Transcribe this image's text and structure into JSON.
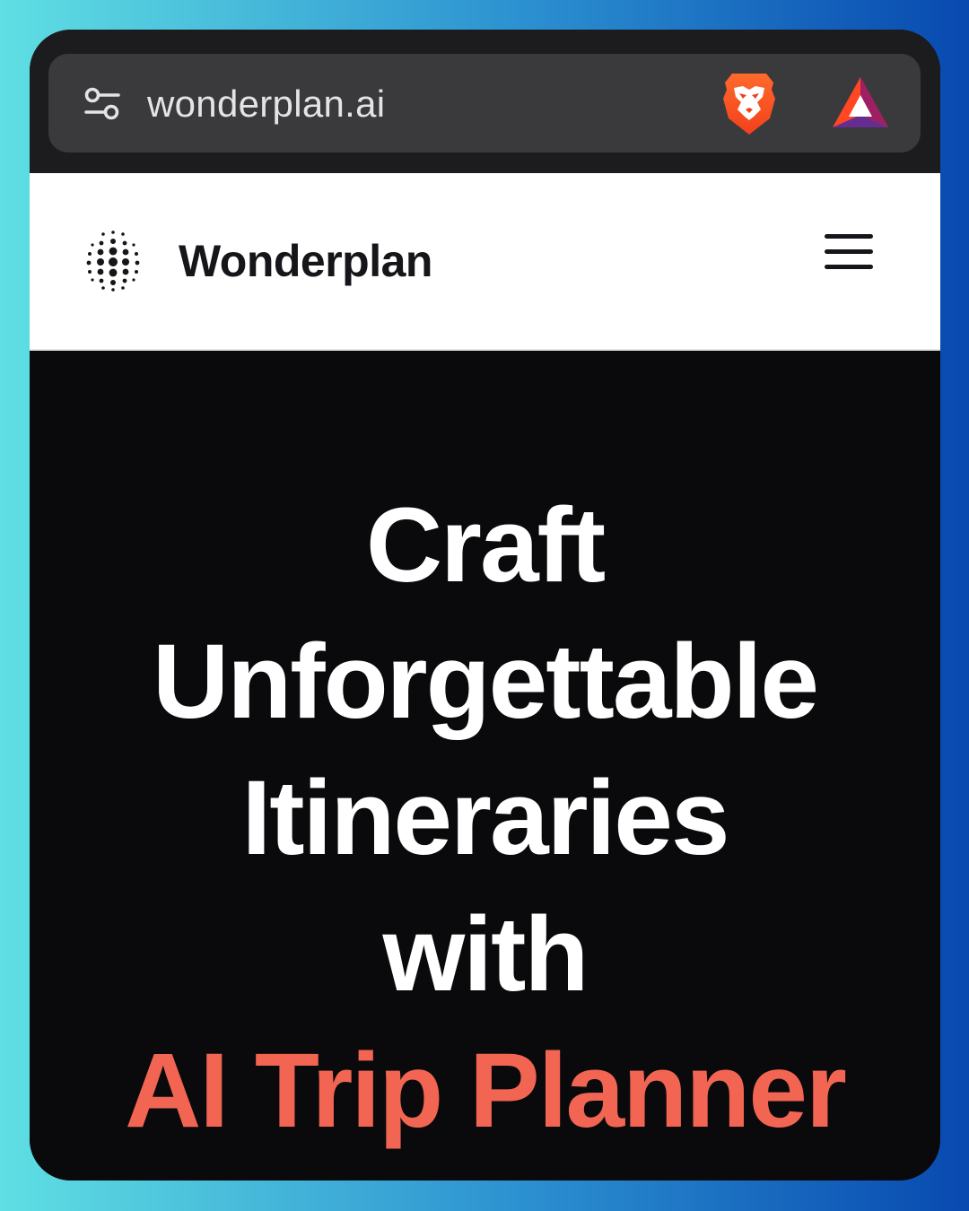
{
  "browser": {
    "url": "wonderplan.ai",
    "icons": [
      "tune-icon",
      "brave-lion-icon",
      "bat-rewards-icon"
    ]
  },
  "site": {
    "brand": "Wonderplan",
    "logo_icon": "dot-grid-logo-icon",
    "menu_icon": "hamburger-menu-icon"
  },
  "hero": {
    "line1": "Craft",
    "line2": "Unforgettable",
    "line3": "Itineraries",
    "line4": "with",
    "line5": "AI Trip Planner"
  },
  "colors": {
    "accent": "#f26552",
    "hero_background": "#0a0a0c",
    "header_background": "#ffffff",
    "browser_bar": "#1c1c1e"
  }
}
